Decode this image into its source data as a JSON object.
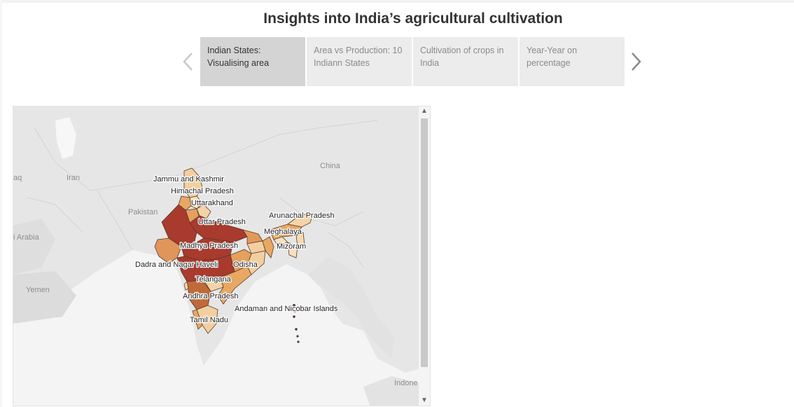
{
  "title": "Insights into India’s agricultural cultivation",
  "navigation": {
    "prev_icon": "chevron-left-icon",
    "next_icon": "chevron-right-icon"
  },
  "story_points": [
    {
      "label": "Indian States: Visualising area",
      "active": true
    },
    {
      "label": "Area vs Production: 10 Indiann States",
      "active": false
    },
    {
      "label": "Cultivation of crops in India",
      "active": false
    },
    {
      "label": "Year-Year on percentage",
      "active": false
    }
  ],
  "map": {
    "country_labels": [
      "aq",
      "Iran",
      "Pakistan",
      "China",
      "i Arabia",
      "Yemen",
      "Indone"
    ],
    "state_labels": [
      "Jammu and Kashmir",
      "Himachal Pradesh",
      "Uttarakhand",
      "Arunachal Pradesh",
      "Uttar Pradesh",
      "Meghalaya",
      "Madhya Pradesh",
      "Mizoram",
      "Dadra and Nagar Haveli",
      "Odisha",
      "Telangana",
      "Andhra Pradesh",
      "Andaman and Nicobar Islands",
      "Tamil Nadu"
    ],
    "color_scale": {
      "low": "#f6d9b0",
      "mid": "#e29a55",
      "high": "#a83a2e"
    }
  },
  "scrollbar": {
    "up_icon": "▲",
    "down_icon": "▼"
  }
}
